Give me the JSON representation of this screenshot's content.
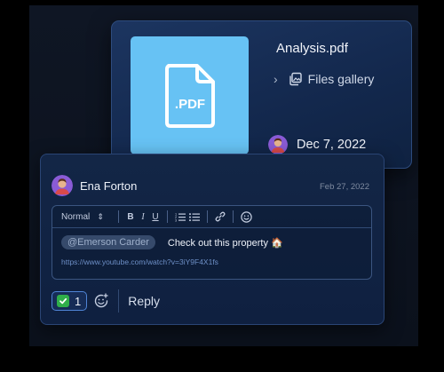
{
  "file": {
    "name": "Analysis.pdf",
    "thumb_label": ".PDF",
    "gallery_label": "Files gallery",
    "date": "Dec 7, 2022",
    "thumb_color": "#67c2f4"
  },
  "comment": {
    "author": "Ena Forton",
    "date": "Feb 27, 2022",
    "toolbar": {
      "style_label": "Normal",
      "bold": "B",
      "italic": "I",
      "underline": "U"
    },
    "mention": "@Emerson Carder",
    "message": "Check out this property 🏠",
    "link": "https://www.youtube.com/watch?v=3iY9F4X1fs",
    "reaction_count": "1",
    "reply_label": "Reply"
  },
  "icons": [
    "pdf-file-icon",
    "chevron-right-icon",
    "gallery-icon",
    "ordered-list-icon",
    "bullet-list-icon",
    "link-icon",
    "emoji-icon",
    "check-icon",
    "add-emoji-icon"
  ],
  "colors": {
    "accent": "#4f84d6",
    "reaction_check": "#2fae4a",
    "mention_bg": "#364a6b",
    "link": "#6d8fc6"
  }
}
